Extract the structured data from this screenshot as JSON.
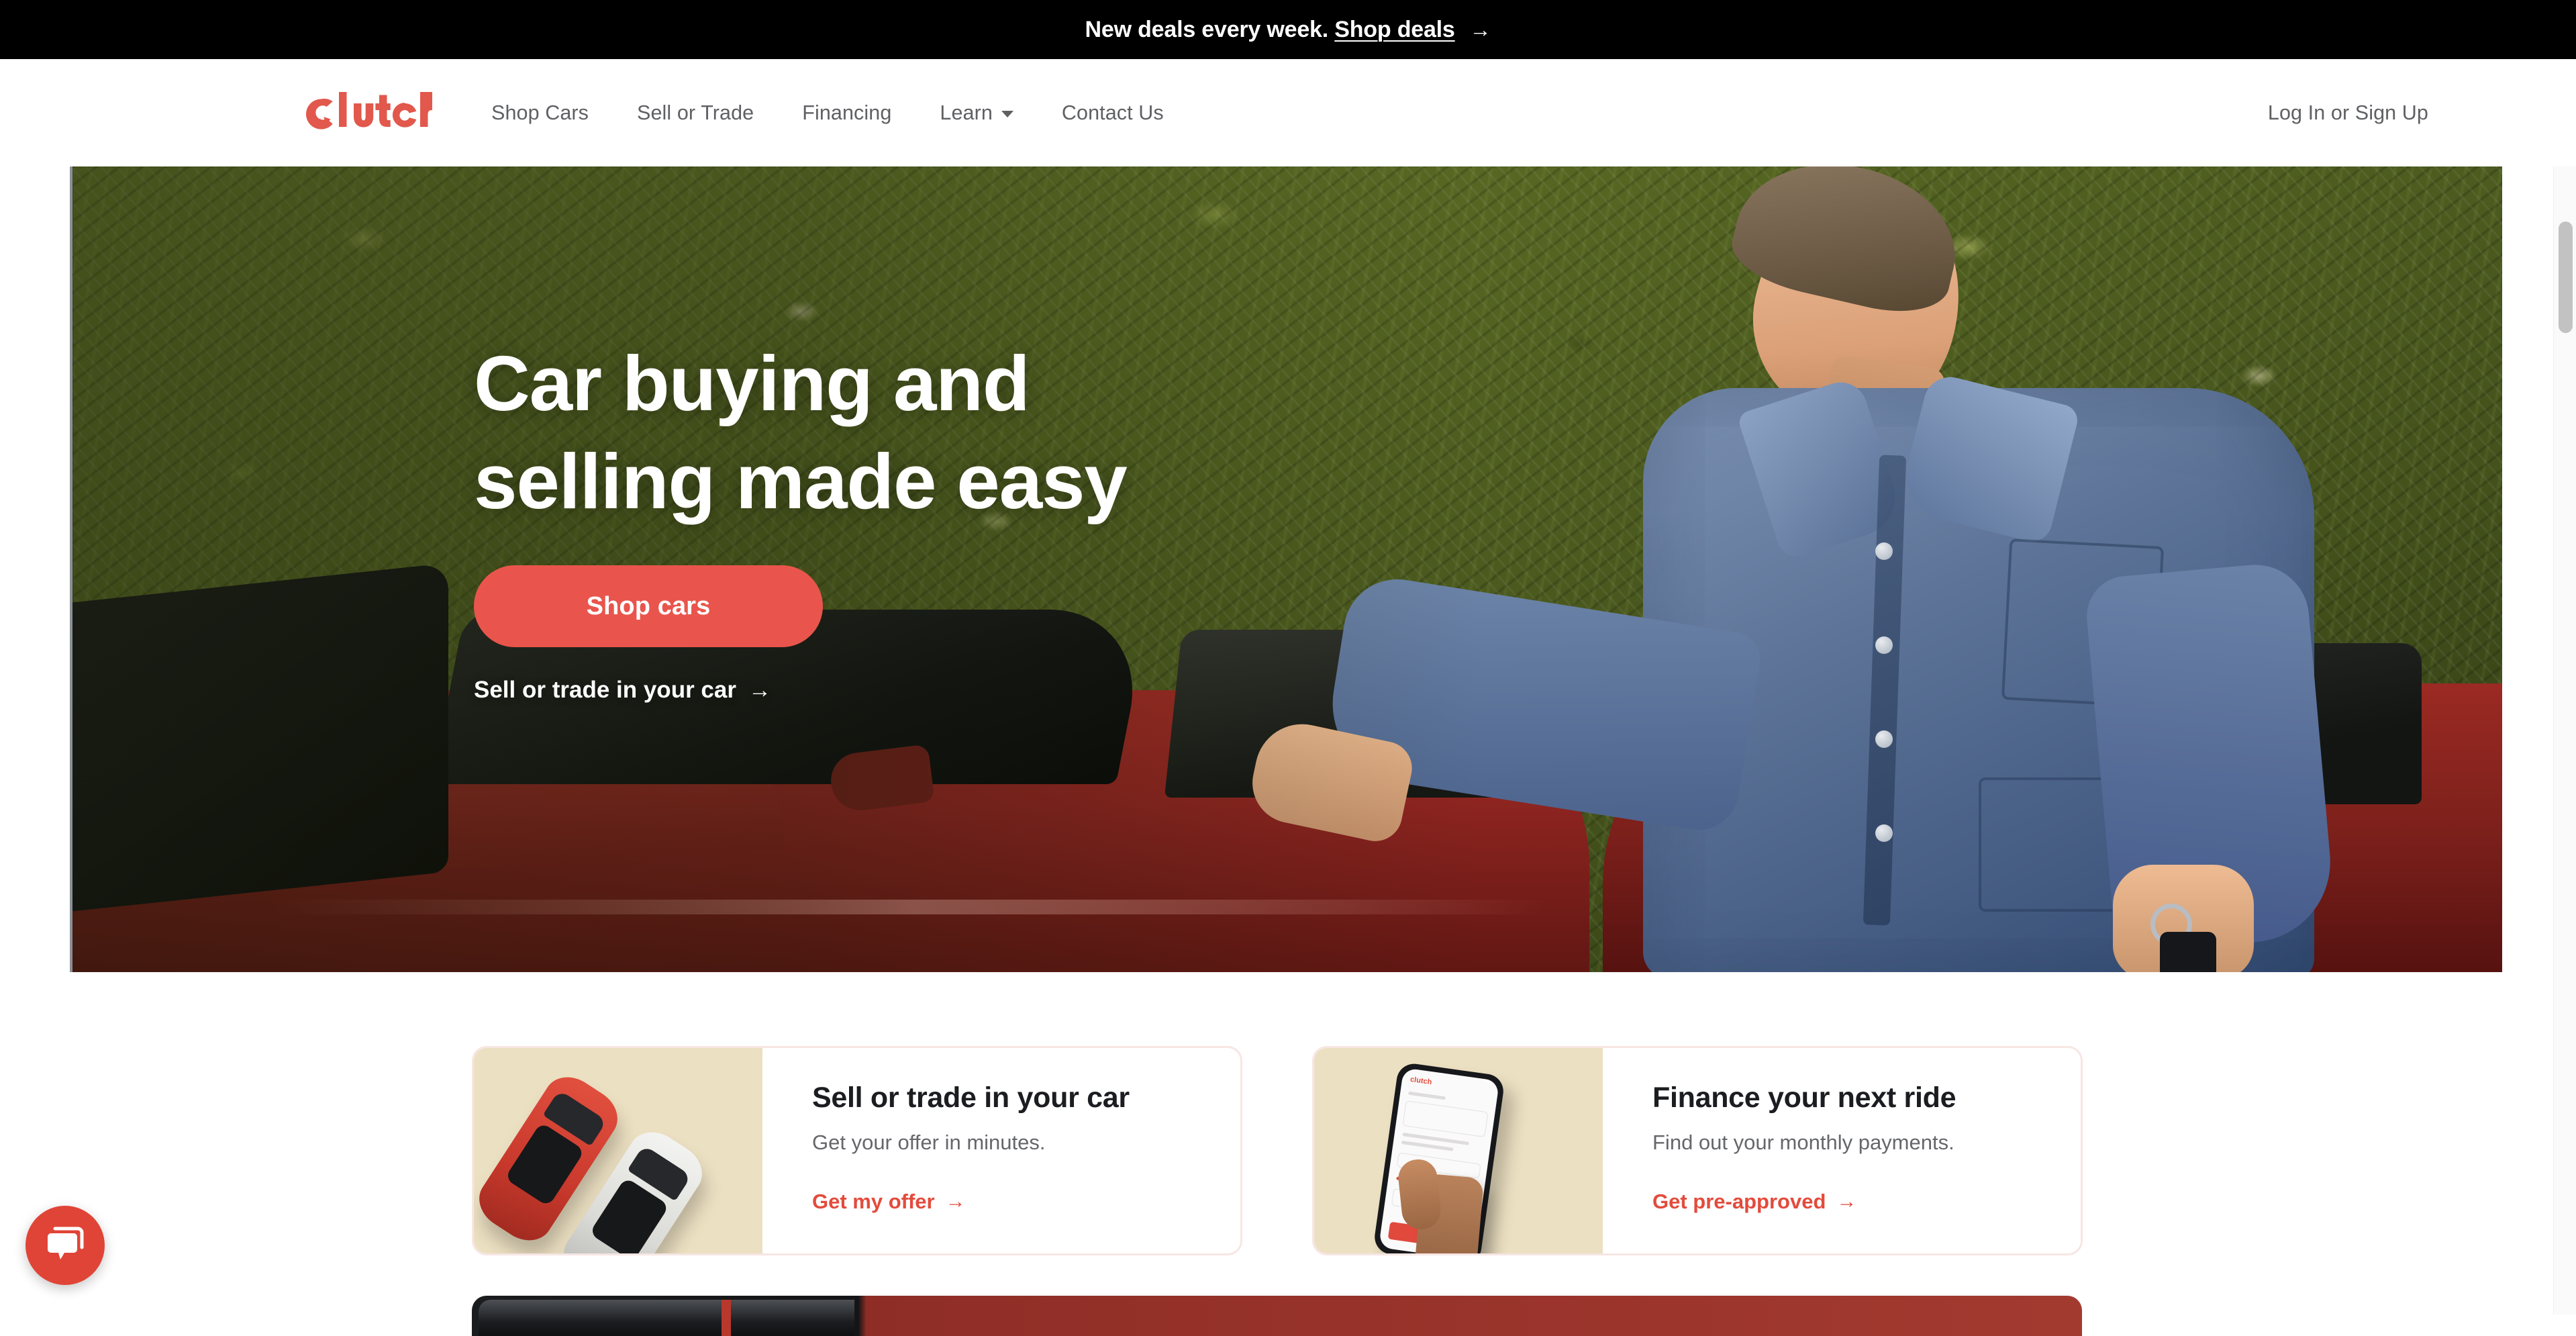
{
  "promo_banner": {
    "text": "New deals every week. ",
    "link_label": "Shop deals",
    "arrow": "→"
  },
  "header": {
    "logo_text": "clutch",
    "nav_items": [
      {
        "label": "Shop Cars",
        "has_chevron": false
      },
      {
        "label": "Sell or Trade",
        "has_chevron": false
      },
      {
        "label": "Financing",
        "has_chevron": false
      },
      {
        "label": "Learn",
        "has_chevron": true
      },
      {
        "label": "Contact Us",
        "has_chevron": false
      }
    ],
    "auth_label": "Log In or Sign Up"
  },
  "hero": {
    "title": "Car buying and\nselling made easy",
    "primary_button": "Shop cars",
    "secondary_link": "Sell or trade in your car",
    "secondary_arrow": "→",
    "image_alt": "Man in denim jacket holding clutch keys beside a red car in front of an ivy wall"
  },
  "cards": [
    {
      "title": "Sell or trade in your car",
      "subtitle": "Get your offer in minutes.",
      "link_label": "Get my offer",
      "link_arrow": "→",
      "media": "two-cars-top-down"
    },
    {
      "title": "Finance your next ride",
      "subtitle": "Find out your monthly payments.",
      "link_label": "Get pre-approved",
      "link_arrow": "→",
      "media": "hand-holding-phone",
      "phone_app_logo": "clutch"
    }
  ],
  "chat_widget": {
    "icon": "chat-bubble-icon"
  },
  "colors": {
    "brand_red": "#e9554c",
    "link_red": "#e34b3c",
    "banner_bg": "#000000",
    "nav_text": "#5f6063",
    "card_border": "#f7e6e4",
    "card_media_bg": "#ece0c2",
    "heading_dark": "#1c1d21",
    "sub_gray": "#66676b"
  }
}
